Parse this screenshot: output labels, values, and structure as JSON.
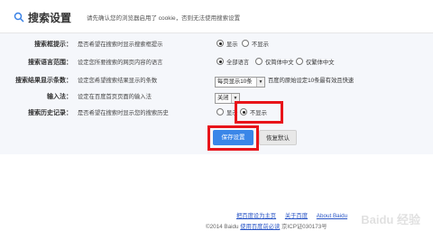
{
  "header": {
    "title": "搜索设置",
    "note": "请先确认您的浏览器启用了 cookie，否则无法使用搜索设置"
  },
  "settings": {
    "suggest": {
      "label": "搜索框提示：",
      "desc": "是否希望在搜索时显示搜索框提示",
      "options": [
        "显示",
        "不显示"
      ],
      "selected": "显示"
    },
    "language": {
      "label": "搜索语言范围：",
      "desc": "设定您所要搜索的网页内容的语言",
      "options": [
        "全部语言",
        "仅简体中文",
        "仅繁体中文"
      ],
      "selected": "全部语言"
    },
    "results": {
      "label": "搜索结果显示条数：",
      "desc": "设定您希望搜索结果显示的条数",
      "select_value": "每页显示10条",
      "note": "百度的原始设定10条最有效且快速"
    },
    "input_method": {
      "label": "输入法：",
      "desc": "设定在百度首页页面的输入法",
      "select_value": "关闭"
    },
    "history": {
      "label": "搜索历史记录：",
      "desc": "是否希望在搜索时显示您的搜索历史",
      "options": [
        "显示",
        "不显示"
      ],
      "selected": "不显示"
    }
  },
  "buttons": {
    "save": "保存设置",
    "reset": "恢复默认"
  },
  "footer": {
    "links": [
      "把百度设为主页",
      "关于百度",
      "About Baidu"
    ],
    "copyright_prefix": "©2014 Baidu",
    "copyright_link": "使用百度前必读",
    "icp": "京ICP证030173号"
  },
  "watermark": "Baidu 经验",
  "colors": {
    "accent": "#3a86e8",
    "highlight": "#e8141a",
    "panel_bg": "#f5f7fb",
    "link": "#2a56c6"
  }
}
